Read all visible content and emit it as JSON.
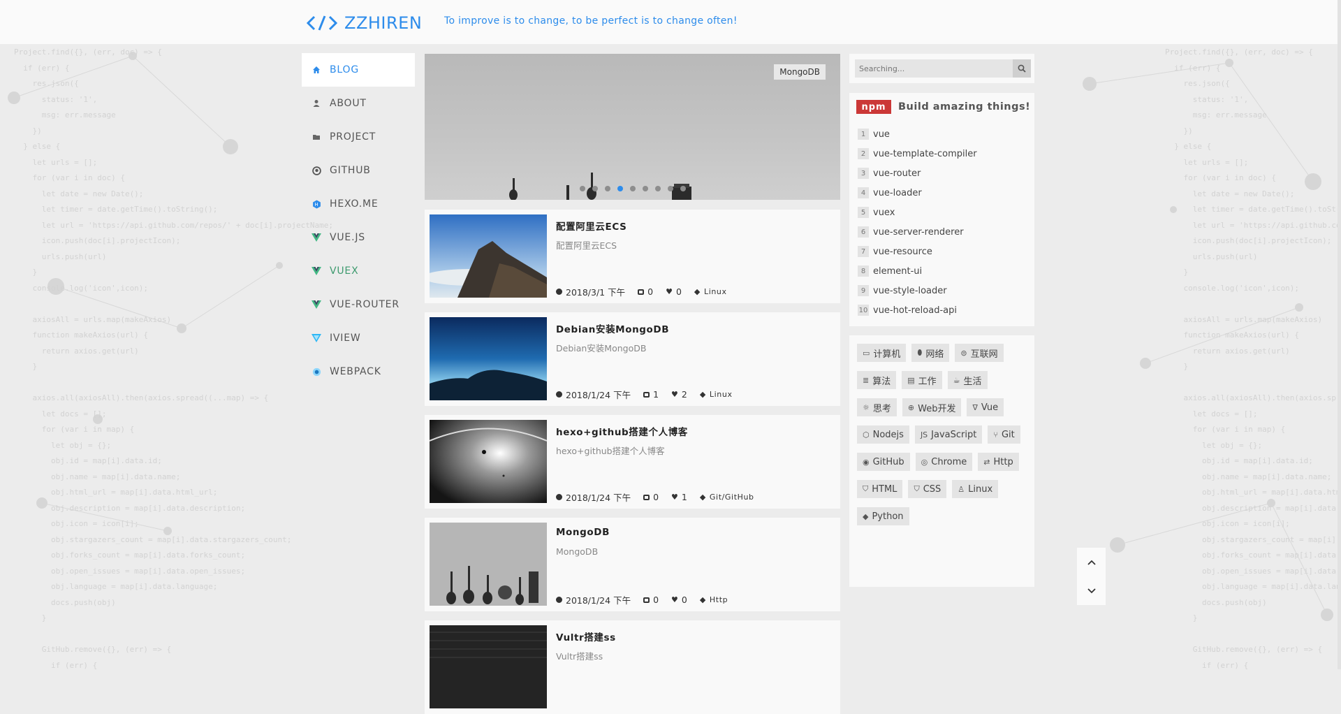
{
  "header": {
    "logo_text": "ZZHIREN",
    "motto": "To improve is to change, to be perfect is to change often!"
  },
  "nav": {
    "items": [
      {
        "label": "BLOG",
        "icon": "home-icon"
      },
      {
        "label": "ABOUT",
        "icon": "user-icon"
      },
      {
        "label": "PROJECT",
        "icon": "folder-icon"
      },
      {
        "label": "GITHUB",
        "icon": "github-icon"
      },
      {
        "label": "HEXO.ME",
        "icon": "hexo-icon"
      },
      {
        "label": "VUE.JS",
        "icon": "vue-icon"
      },
      {
        "label": "VUEX",
        "icon": "vue-icon"
      },
      {
        "label": "VUE-ROUTER",
        "icon": "vue-icon"
      },
      {
        "label": "IVIEW",
        "icon": "iview-icon"
      },
      {
        "label": "WEBPACK",
        "icon": "webpack-icon"
      }
    ]
  },
  "banner": {
    "tag": "MongoDB",
    "dot_count": 9,
    "active_dot": 3
  },
  "posts": [
    {
      "title": "配置阿里云ECS",
      "subtitle": "配置阿里云ECS",
      "date": "2018/3/1 下午",
      "comments": "0",
      "likes": "0",
      "tag": "Linux"
    },
    {
      "title": "Debian安装MongoDB",
      "subtitle": "Debian安装MongoDB",
      "date": "2018/1/24 下午",
      "comments": "1",
      "likes": "2",
      "tag": "Linux"
    },
    {
      "title": "hexo+github搭建个人博客",
      "subtitle": "hexo+github搭建个人博客",
      "date": "2018/1/24 下午",
      "comments": "0",
      "likes": "1",
      "tag": "Git/GitHub"
    },
    {
      "title": "MongoDB",
      "subtitle": "MongoDB",
      "date": "2018/1/24 下午",
      "comments": "0",
      "likes": "0",
      "tag": "Http"
    },
    {
      "title": "Vultr搭建ss",
      "subtitle": "Vultr搭建ss",
      "date": "",
      "comments": "",
      "likes": "",
      "tag": ""
    }
  ],
  "search": {
    "placeholder": "Searching..."
  },
  "npm": {
    "logo": "npm",
    "heading": "Build amazing things!",
    "packages": [
      {
        "rank": "1",
        "name": "vue"
      },
      {
        "rank": "2",
        "name": "vue-template-compiler"
      },
      {
        "rank": "3",
        "name": "vue-router"
      },
      {
        "rank": "4",
        "name": "vue-loader"
      },
      {
        "rank": "5",
        "name": "vuex"
      },
      {
        "rank": "6",
        "name": "vue-server-renderer"
      },
      {
        "rank": "7",
        "name": "vue-resource"
      },
      {
        "rank": "8",
        "name": "element-ui"
      },
      {
        "rank": "9",
        "name": "vue-style-loader"
      },
      {
        "rank": "10",
        "name": "vue-hot-reload-api"
      }
    ]
  },
  "tags": [
    {
      "label": "计算机",
      "icon": "▭"
    },
    {
      "label": "网络",
      "icon": "⬮"
    },
    {
      "label": "互联网",
      "icon": "⊜"
    },
    {
      "label": "算法",
      "icon": "≣"
    },
    {
      "label": "工作",
      "icon": "▤"
    },
    {
      "label": "生活",
      "icon": "☕"
    },
    {
      "label": "思考",
      "icon": "☼"
    },
    {
      "label": "Web开发",
      "icon": "⊕"
    },
    {
      "label": "Vue",
      "icon": "∇"
    },
    {
      "label": "Nodejs",
      "icon": "⬡"
    },
    {
      "label": "JavaScript",
      "icon": "JS"
    },
    {
      "label": "Git",
      "icon": "⑂"
    },
    {
      "label": "GitHub",
      "icon": "◉"
    },
    {
      "label": "Chrome",
      "icon": "◎"
    },
    {
      "label": "Http",
      "icon": "⇄"
    },
    {
      "label": "HTML",
      "icon": "⛉"
    },
    {
      "label": "CSS",
      "icon": "⛉"
    },
    {
      "label": "Linux",
      "icon": "♙"
    },
    {
      "label": "Python",
      "icon": "◆"
    }
  ],
  "colors": {
    "accent": "#2d8ceb",
    "vue_green": "#3d9a6e",
    "npm_red": "#cb3837"
  }
}
